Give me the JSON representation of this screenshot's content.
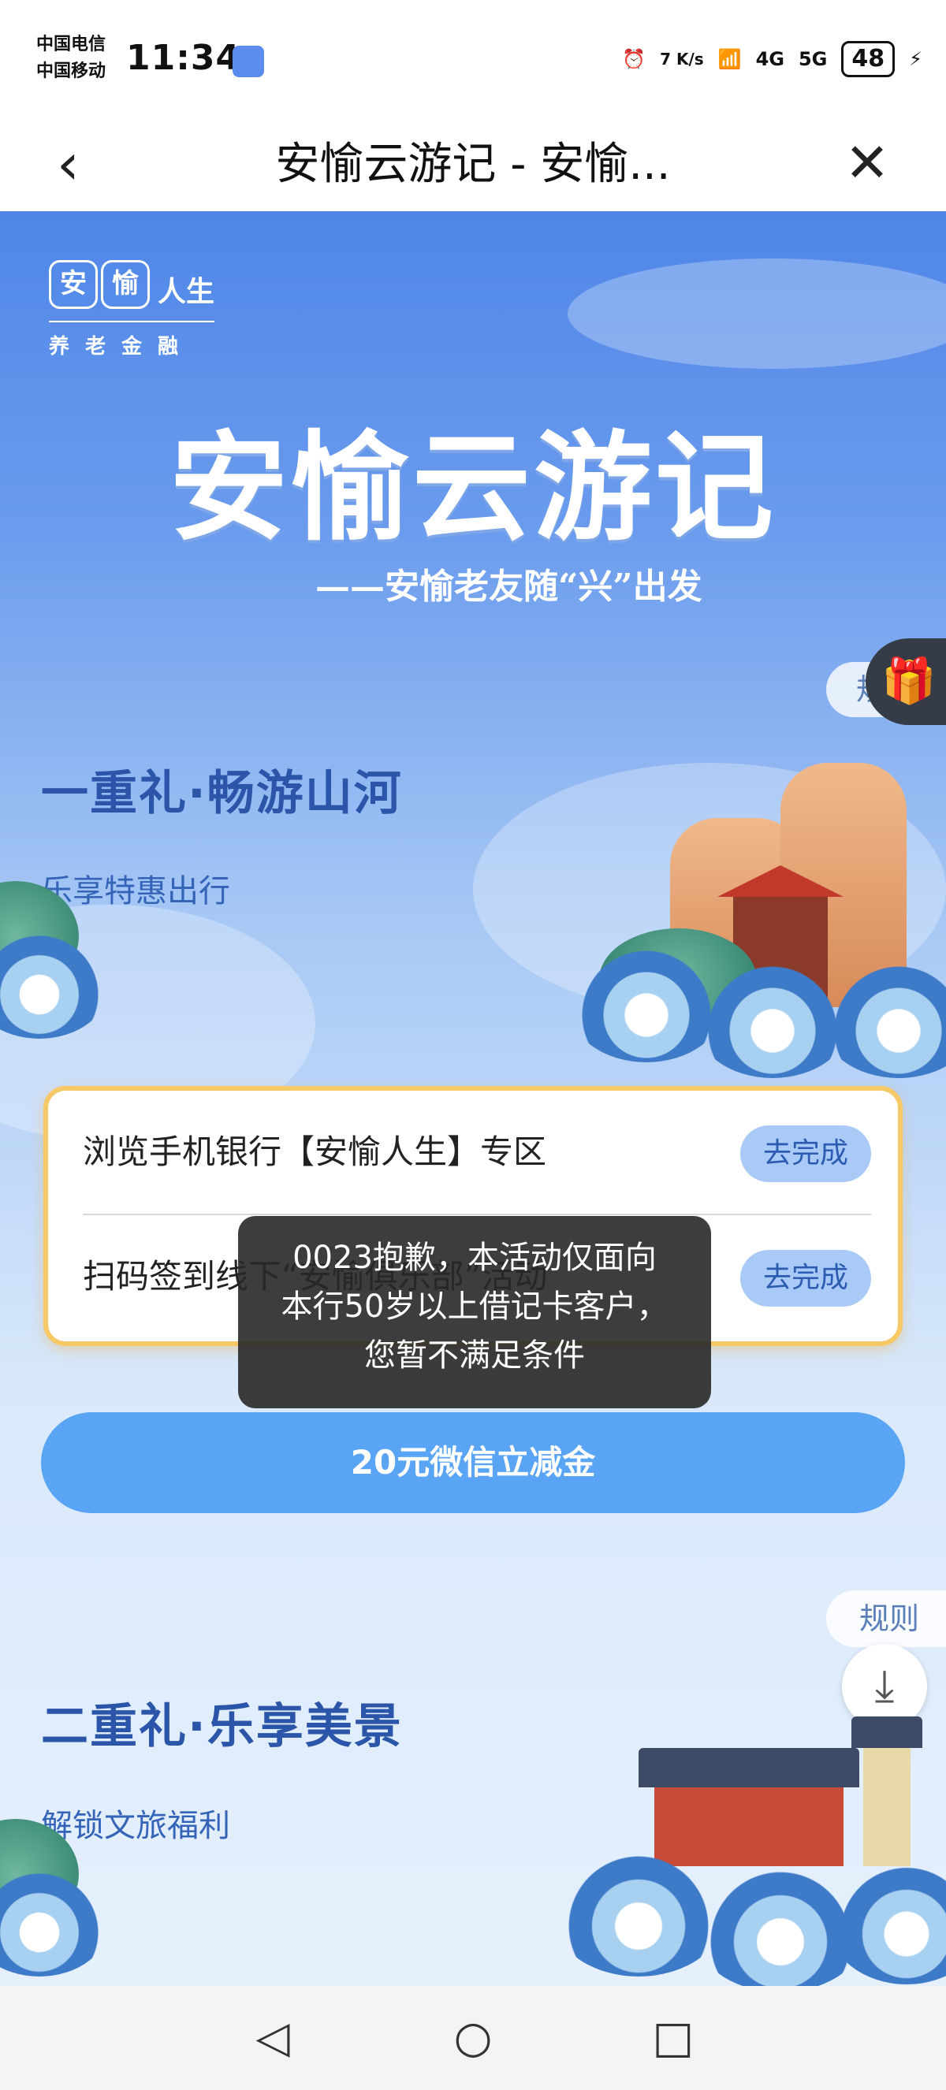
{
  "status_bar": {
    "carrier_1": "中国电信",
    "carrier_2": "中国移动",
    "time": "11:34",
    "net_speed": "7 K/s",
    "net_4g": "4G",
    "net_5g": "5G",
    "battery": "48"
  },
  "nav": {
    "title": "安愉云游记 - 安愉...",
    "back_icon": "chevron-left-icon",
    "close_icon": "close-icon"
  },
  "brand": {
    "logo_char_1": "安",
    "logo_char_2": "愉",
    "logo_name": "人生",
    "logo_tagline": "养老金融"
  },
  "hero": {
    "title": "安愉云游记",
    "subtitle": "——安愉老友随“兴”出发"
  },
  "side": {
    "rules_label": "规则",
    "gift_icon": "gift-icon",
    "download_icon": "download-icon"
  },
  "section1": {
    "title": "一重礼·畅游山河",
    "subtitle": "乐享特惠出行",
    "tasks": [
      {
        "text": "浏览手机银行【安愉人生】专区",
        "button": "去完成"
      },
      {
        "text": "扫码签到线下“安愉俱乐部”活动",
        "button": "去完成"
      }
    ],
    "reward_button": "20元微信立减金"
  },
  "section2": {
    "title": "二重礼·乐享美景",
    "subtitle": "解锁文旅福利"
  },
  "toast": {
    "message": "0023抱歉，本活动仅面向本行50岁以上借记卡客户，您暂不满足条件"
  },
  "system_nav": {
    "back_icon": "triangle-back-icon",
    "home_icon": "circle-home-icon",
    "recents_icon": "square-recents-icon"
  },
  "colors": {
    "accent_blue": "#5aa4f5",
    "title_blue": "#2a55a8",
    "card_border": "#f6c866"
  }
}
